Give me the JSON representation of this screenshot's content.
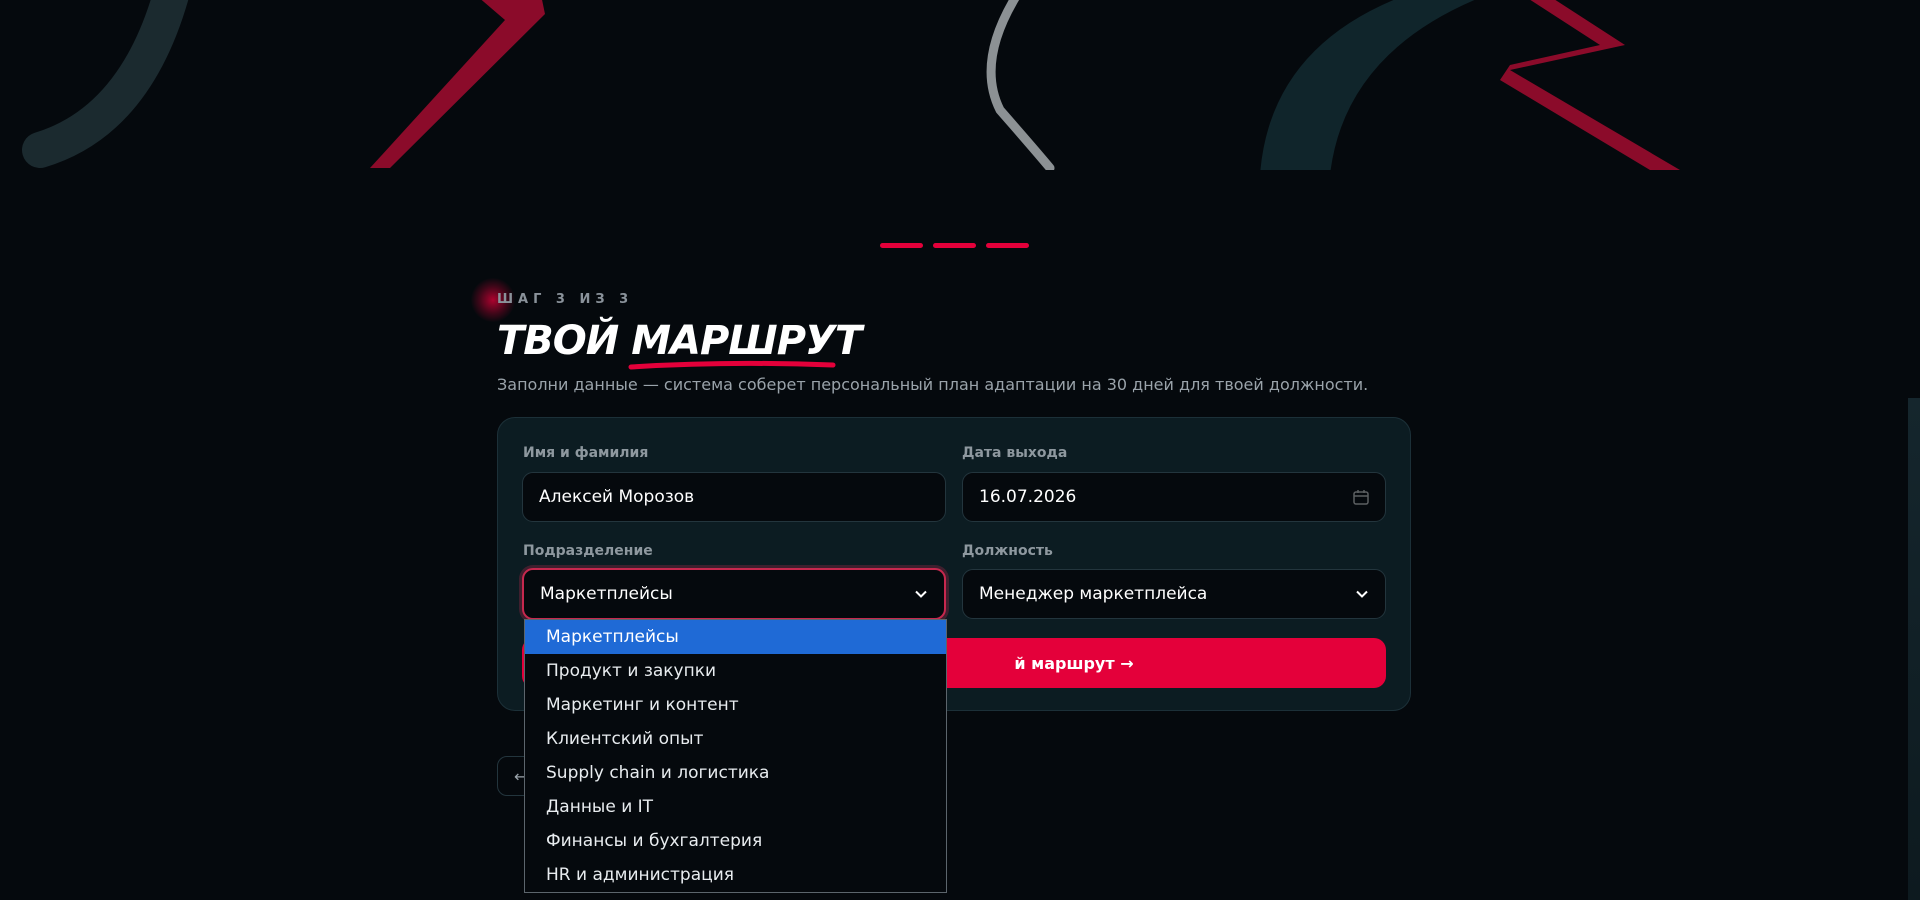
{
  "progress": {
    "steps_total": 3,
    "steps_done": 3
  },
  "header": {
    "step": "ШАГ 3 ИЗ 3",
    "title_plain": "ТВОЙ",
    "title_accent": "МАРШРУТ",
    "subtitle": "Заполни данные — система соберет персональный план адаптации на 30 дней для твоей должности."
  },
  "form": {
    "name_label": "Имя и фамилия",
    "name_value": "Алексей Морозов",
    "date_label": "Дата выхода",
    "date_value": "16.07.2026",
    "department_label": "Подразделение",
    "department_value": "Маркетплейсы",
    "position_label": "Должность",
    "position_value": "Менеджер маркетплейса",
    "submit_label": "й маршрут →"
  },
  "back_button": {
    "label": "←"
  },
  "department_options": [
    "Маркетплейсы",
    "Продукт и закупки",
    "Маркетинг и контент",
    "Клиентский опыт",
    "Supply chain и логистика",
    "Данные и IT",
    "Финансы и бухгалтерия",
    "HR и администрация"
  ],
  "colors": {
    "accent": "#e4003a",
    "background": "#05090d",
    "card": "#0c1c22",
    "highlight": "#1f6ad6"
  }
}
